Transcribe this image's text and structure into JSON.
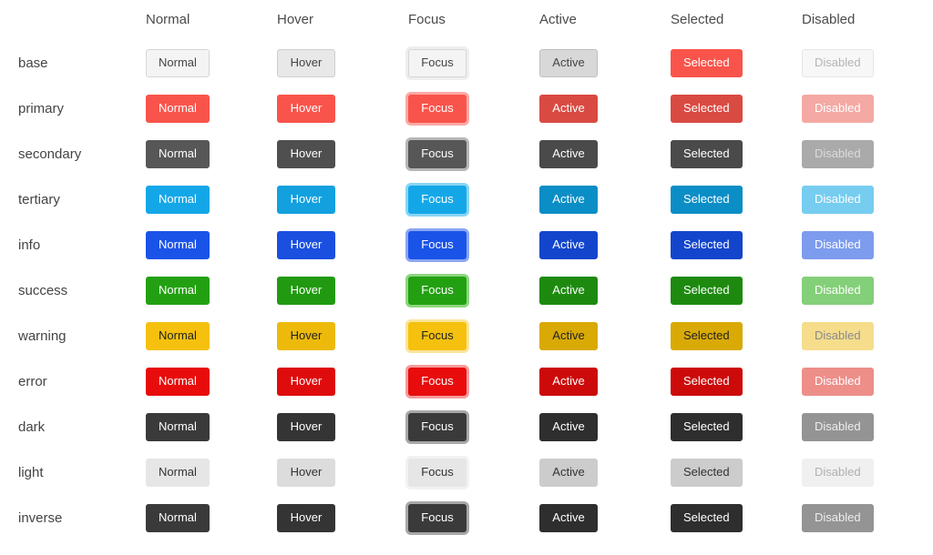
{
  "table": {
    "corner_label": "",
    "column_headers": [
      "Normal",
      "Hover",
      "Focus",
      "Active",
      "Selected",
      "Disabled"
    ],
    "state_keys": [
      "normal",
      "hover",
      "focus",
      "active",
      "selected",
      "disabled"
    ],
    "rows": [
      {
        "label": "base",
        "cells": [
          {
            "text": "Normal",
            "bg": "#f4f4f4",
            "fg": "#444444",
            "border": "#d6d6d6"
          },
          {
            "text": "Hover",
            "bg": "#e8e8e8",
            "fg": "#444444",
            "border": "#cfcfcf"
          },
          {
            "text": "Focus",
            "bg": "#f4f4f4",
            "fg": "#444444",
            "border": "#d6d6d6",
            "ring": "#eeeeee"
          },
          {
            "text": "Active",
            "bg": "#d8d8d8",
            "fg": "#444444",
            "border": "#bfbfbf"
          },
          {
            "text": "Selected",
            "bg": "#f9544b",
            "fg": "#ffffff",
            "border": "#f9544b"
          },
          {
            "text": "Disabled",
            "bg": "#f7f7f7",
            "fg": "#b5b5b5",
            "border": "#e6e6e6"
          }
        ]
      },
      {
        "label": "primary",
        "cells": [
          {
            "text": "Normal",
            "bg": "#f9544b",
            "fg": "#ffffff",
            "border": "#f9544b"
          },
          {
            "text": "Hover",
            "bg": "#f9544b",
            "fg": "#ffffff",
            "border": "#f9544b"
          },
          {
            "text": "Focus",
            "bg": "#f9544b",
            "fg": "#ffffff",
            "border": "#f9544b",
            "ring": "#fbaaa5"
          },
          {
            "text": "Active",
            "bg": "#d94a42",
            "fg": "#ffffff",
            "border": "#d94a42"
          },
          {
            "text": "Selected",
            "bg": "#d94a42",
            "fg": "#ffffff",
            "border": "#d94a42"
          },
          {
            "text": "Disabled",
            "bg": "#f4a9a4",
            "fg": "#ffffff",
            "border": "#f4a9a4"
          }
        ]
      },
      {
        "label": "secondary",
        "cells": [
          {
            "text": "Normal",
            "bg": "#575757",
            "fg": "#ffffff",
            "border": "#575757"
          },
          {
            "text": "Hover",
            "bg": "#4f4f4f",
            "fg": "#ffffff",
            "border": "#4f4f4f"
          },
          {
            "text": "Focus",
            "bg": "#575757",
            "fg": "#ffffff",
            "border": "#575757",
            "ring": "#b7b7b7"
          },
          {
            "text": "Active",
            "bg": "#4a4a4a",
            "fg": "#ffffff",
            "border": "#4a4a4a"
          },
          {
            "text": "Selected",
            "bg": "#4a4a4a",
            "fg": "#ffffff",
            "border": "#4a4a4a"
          },
          {
            "text": "Disabled",
            "bg": "#aaaaaa",
            "fg": "#dcdcdc",
            "border": "#aaaaaa"
          }
        ]
      },
      {
        "label": "tertiary",
        "cells": [
          {
            "text": "Normal",
            "bg": "#14a7e8",
            "fg": "#ffffff",
            "border": "#14a7e8"
          },
          {
            "text": "Hover",
            "bg": "#12a0de",
            "fg": "#ffffff",
            "border": "#12a0de"
          },
          {
            "text": "Focus",
            "bg": "#14a7e8",
            "fg": "#ffffff",
            "border": "#14a7e8",
            "ring": "#87d6f4"
          },
          {
            "text": "Active",
            "bg": "#0b8ec6",
            "fg": "#ffffff",
            "border": "#0b8ec6"
          },
          {
            "text": "Selected",
            "bg": "#0b8ec6",
            "fg": "#ffffff",
            "border": "#0b8ec6"
          },
          {
            "text": "Disabled",
            "bg": "#76cdf0",
            "fg": "#ffffff",
            "border": "#76cdf0"
          }
        ]
      },
      {
        "label": "info",
        "cells": [
          {
            "text": "Normal",
            "bg": "#1a53e8",
            "fg": "#ffffff",
            "border": "#1a53e8"
          },
          {
            "text": "Hover",
            "bg": "#1a4fe0",
            "fg": "#ffffff",
            "border": "#1a4fe0"
          },
          {
            "text": "Focus",
            "bg": "#1a53e8",
            "fg": "#ffffff",
            "border": "#1a53e8",
            "ring": "#8ba6f2"
          },
          {
            "text": "Active",
            "bg": "#1345cc",
            "fg": "#ffffff",
            "border": "#1345cc"
          },
          {
            "text": "Selected",
            "bg": "#1345cc",
            "fg": "#ffffff",
            "border": "#1345cc"
          },
          {
            "text": "Disabled",
            "bg": "#7d9cee",
            "fg": "#ffffff",
            "border": "#7d9cee"
          }
        ]
      },
      {
        "label": "success",
        "cells": [
          {
            "text": "Normal",
            "bg": "#23a012",
            "fg": "#ffffff",
            "border": "#23a012"
          },
          {
            "text": "Hover",
            "bg": "#219a11",
            "fg": "#ffffff",
            "border": "#219a11"
          },
          {
            "text": "Focus",
            "bg": "#23a012",
            "fg": "#ffffff",
            "border": "#23a012",
            "ring": "#8cd77f"
          },
          {
            "text": "Active",
            "bg": "#1d8a0f",
            "fg": "#ffffff",
            "border": "#1d8a0f"
          },
          {
            "text": "Selected",
            "bg": "#1d8a0f",
            "fg": "#ffffff",
            "border": "#1d8a0f"
          },
          {
            "text": "Disabled",
            "bg": "#84cf79",
            "fg": "#ffffff",
            "border": "#84cf79"
          }
        ]
      },
      {
        "label": "warning",
        "cells": [
          {
            "text": "Normal",
            "bg": "#f5c10e",
            "fg": "#222222",
            "border": "#f5c10e"
          },
          {
            "text": "Hover",
            "bg": "#edba0c",
            "fg": "#222222",
            "border": "#edba0c"
          },
          {
            "text": "Focus",
            "bg": "#f5c10e",
            "fg": "#222222",
            "border": "#f5c10e",
            "ring": "#fae49a"
          },
          {
            "text": "Active",
            "bg": "#d9aa06",
            "fg": "#222222",
            "border": "#d9aa06"
          },
          {
            "text": "Selected",
            "bg": "#d9aa06",
            "fg": "#222222",
            "border": "#d9aa06"
          },
          {
            "text": "Disabled",
            "bg": "#f5dd8c",
            "fg": "#8a8a8a",
            "border": "#f5dd8c"
          }
        ]
      },
      {
        "label": "error",
        "cells": [
          {
            "text": "Normal",
            "bg": "#e80c0c",
            "fg": "#ffffff",
            "border": "#e80c0c"
          },
          {
            "text": "Hover",
            "bg": "#de0c0c",
            "fg": "#ffffff",
            "border": "#de0c0c"
          },
          {
            "text": "Focus",
            "bg": "#e80c0c",
            "fg": "#ffffff",
            "border": "#e80c0c",
            "ring": "#f69b9b"
          },
          {
            "text": "Active",
            "bg": "#cc0a0a",
            "fg": "#ffffff",
            "border": "#cc0a0a"
          },
          {
            "text": "Selected",
            "bg": "#cc0a0a",
            "fg": "#ffffff",
            "border": "#cc0a0a"
          },
          {
            "text": "Disabled",
            "bg": "#ed8e89",
            "fg": "#ffffff",
            "border": "#ed8e89"
          }
        ]
      },
      {
        "label": "dark",
        "cells": [
          {
            "text": "Normal",
            "bg": "#3a3a3a",
            "fg": "#ffffff",
            "border": "#3a3a3a"
          },
          {
            "text": "Hover",
            "bg": "#343434",
            "fg": "#ffffff",
            "border": "#343434"
          },
          {
            "text": "Focus",
            "bg": "#3a3a3a",
            "fg": "#ffffff",
            "border": "#3a3a3a",
            "ring": "#a8a8a8"
          },
          {
            "text": "Active",
            "bg": "#2e2e2e",
            "fg": "#ffffff",
            "border": "#2e2e2e"
          },
          {
            "text": "Selected",
            "bg": "#2e2e2e",
            "fg": "#ffffff",
            "border": "#2e2e2e"
          },
          {
            "text": "Disabled",
            "bg": "#949494",
            "fg": "#ededed",
            "border": "#949494"
          }
        ]
      },
      {
        "label": "light",
        "cells": [
          {
            "text": "Normal",
            "bg": "#e6e6e6",
            "fg": "#333333",
            "border": "#e6e6e6"
          },
          {
            "text": "Hover",
            "bg": "#dcdcdc",
            "fg": "#333333",
            "border": "#dcdcdc"
          },
          {
            "text": "Focus",
            "bg": "#e6e6e6",
            "fg": "#333333",
            "border": "#e6e6e6",
            "ring": "#f2f2f2"
          },
          {
            "text": "Active",
            "bg": "#cccccc",
            "fg": "#333333",
            "border": "#cccccc"
          },
          {
            "text": "Selected",
            "bg": "#cccccc",
            "fg": "#333333",
            "border": "#cccccc"
          },
          {
            "text": "Disabled",
            "bg": "#f0f0f0",
            "fg": "#b0b0b0",
            "border": "#f0f0f0"
          }
        ]
      },
      {
        "label": "inverse",
        "cells": [
          {
            "text": "Normal",
            "bg": "#3a3a3a",
            "fg": "#ffffff",
            "border": "#3a3a3a"
          },
          {
            "text": "Hover",
            "bg": "#343434",
            "fg": "#ffffff",
            "border": "#343434"
          },
          {
            "text": "Focus",
            "bg": "#3a3a3a",
            "fg": "#ffffff",
            "border": "#3a3a3a",
            "ring": "#a8a8a8"
          },
          {
            "text": "Active",
            "bg": "#2e2e2e",
            "fg": "#ffffff",
            "border": "#2e2e2e"
          },
          {
            "text": "Selected",
            "bg": "#2e2e2e",
            "fg": "#ffffff",
            "border": "#2e2e2e"
          },
          {
            "text": "Disabled",
            "bg": "#949494",
            "fg": "#ededed",
            "border": "#949494"
          }
        ]
      }
    ]
  },
  "page": {
    "background": "#ffffff",
    "label_color": "#444444",
    "header_color": "#4a4a4a"
  }
}
